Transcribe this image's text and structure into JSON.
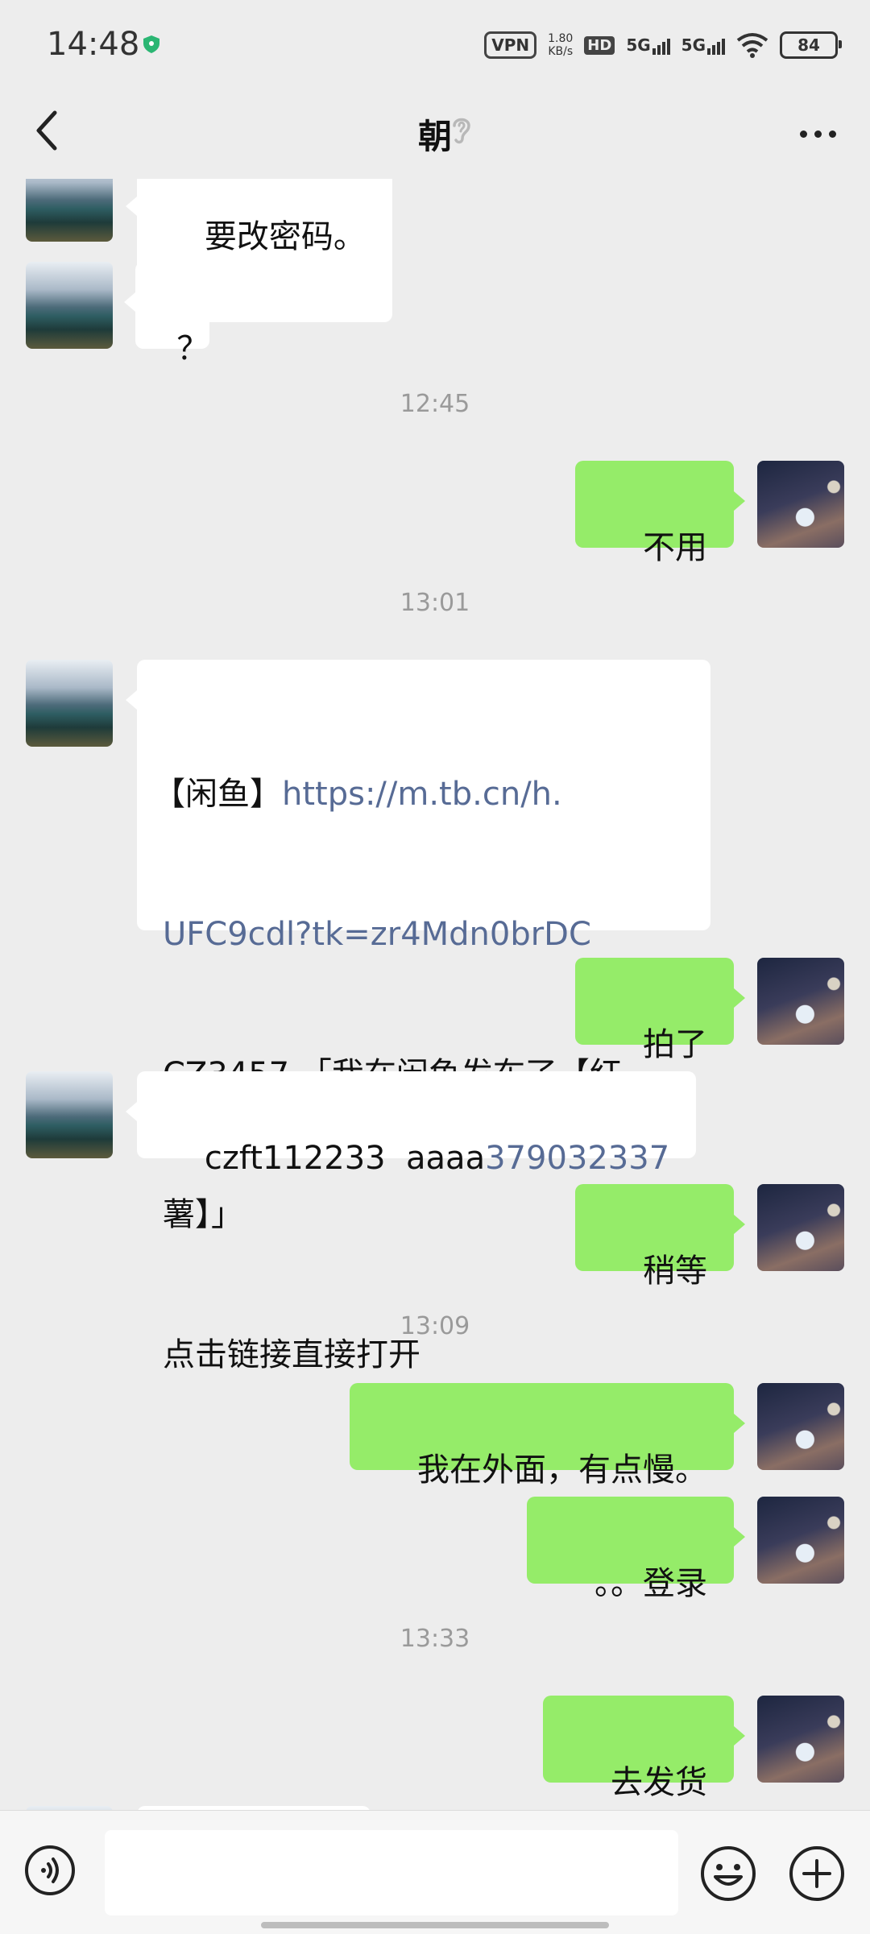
{
  "status_bar": {
    "time": "14:48",
    "vpn": "VPN",
    "net_speed_value": "1.80",
    "net_speed_unit": "KB/s",
    "hd": "HD",
    "sim1": "5G",
    "sim2": "5G",
    "battery": "84",
    "accent_color": "#2bb673"
  },
  "nav": {
    "title": "朝",
    "back_icon": "chevron-left-icon",
    "earpiece_icon": "ear-icon",
    "more_icon": "more-icon"
  },
  "messages": [
    {
      "dir": "in",
      "text": "要改密码。"
    },
    {
      "dir": "in",
      "text": "？"
    },
    {
      "type": "time",
      "text": "12:45"
    },
    {
      "dir": "out",
      "text": "不用"
    },
    {
      "type": "time",
      "text": "13:01"
    },
    {
      "dir": "in",
      "line1_prefix": "【闲鱼】",
      "line1_link": "https://m.tb.cn/h.",
      "line2_link": "UFC9cdl?tk=zr4Mdn0brDC",
      "line3": "CZ3457 「我在闲鱼发布了【红",
      "line4": "薯】」",
      "line5": "点击链接直接打开"
    },
    {
      "dir": "out",
      "text": "拍了"
    },
    {
      "dir": "in",
      "text_prefix": "czft112233  aaaa",
      "text_link": "379032337"
    },
    {
      "dir": "out",
      "text": "稍等"
    },
    {
      "type": "time",
      "text": "13:09"
    },
    {
      "dir": "out",
      "text": "我在外面，有点慢。"
    },
    {
      "dir": "out",
      "text": "。。登录"
    },
    {
      "type": "time",
      "text": "13:33"
    },
    {
      "dir": "out",
      "text": "去发货"
    }
  ],
  "input_bar": {
    "voice_icon": "voice-icon",
    "emoji_icon": "emoji-icon",
    "plus_icon": "plus-icon",
    "value": ""
  },
  "colors": {
    "background": "#ededed",
    "bubble_out": "#95ec69",
    "bubble_in": "#ffffff",
    "link": "#576b95"
  }
}
